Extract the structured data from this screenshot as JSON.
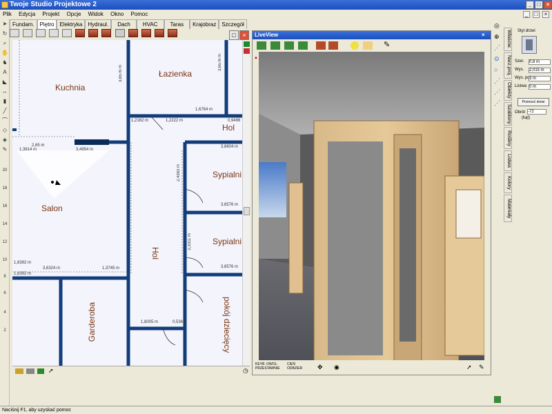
{
  "window": {
    "title": "Twoje Studio Projektowe 2"
  },
  "menu": [
    "Plik",
    "Edycja",
    "Projekt",
    "Opcje",
    "Widok",
    "Okno",
    "Pomoc"
  ],
  "tabs": [
    "Fundam.",
    "Piętro",
    "Elektryka",
    "Hydraul.",
    "Dach",
    "HVAC",
    "Taras",
    "Krajobraz",
    "Szczegół"
  ],
  "active_tab": "Piętro",
  "rooms": {
    "kuchnia": "Kuchnia",
    "lazienka": "Łazienka",
    "hol_top": "Hol",
    "sypialni1": "Sypialni",
    "salon": "Salon",
    "sypialni2": "Sypialni",
    "hol_mid": "Hol",
    "garderoba": "Garderoba",
    "pokoj": "pokój dziecięcy"
  },
  "dimensions": {
    "d1": "1,6764 m",
    "d2": "1,2162 m",
    "d3": "1,2222 m",
    "d4": "0,9496",
    "d5": "1,3814 m",
    "d6": "3,4954 m",
    "d7": "3,6604 m",
    "d8": "3,6576 m",
    "d9": "3,6576 m",
    "d10": "1,8392 m",
    "d11": "3,6324 m",
    "d12": "1,3745 m",
    "d13": "1,8392 m",
    "d14": "1,8005 m",
    "d15": "0,5363",
    "d16": "2,4383 m",
    "d17": "2,3311 m",
    "d18": "3,6576 m",
    "d19": "2,65 m",
    "d20": "3,6576 m"
  },
  "ruler": [
    "20",
    "18",
    "16",
    "14",
    "12",
    "10",
    "8",
    "6",
    "4",
    "2"
  ],
  "liveview": {
    "title": "LiveView",
    "bottom_left": "KEYB. OWOL. PRZESTAWNIE",
    "bottom_mid": "CIEŃ ODBZIER"
  },
  "side_tabs": [
    "Właściw.",
    "Narz.proj.",
    "Obiekty",
    "Szablony",
    "Rośliny",
    "Listwa",
    "Kolory",
    "Materiały"
  ],
  "door_panel": {
    "title": "Styl drzwi",
    "fields": [
      {
        "label": "Szer.",
        "value": "0,8 m"
      },
      {
        "label": "Wys.",
        "value": "2,015 m"
      },
      {
        "label": "Wys. poł.",
        "value": "3 m"
      },
      {
        "label": "Listwa",
        "value": "0 m"
      }
    ],
    "button": "Przerzuć drzwi",
    "rotate_label": "Obrót",
    "rotate_value": "-72",
    "rotate_unit": "(kąt)"
  },
  "status": "Naciśnij F1, aby uzyskać pomoc",
  "colors": {
    "wall": "#123c7a",
    "room_label": "#7a3510",
    "plan_bg": "#f3f4fc",
    "title_blue": "#1c4fbf"
  }
}
